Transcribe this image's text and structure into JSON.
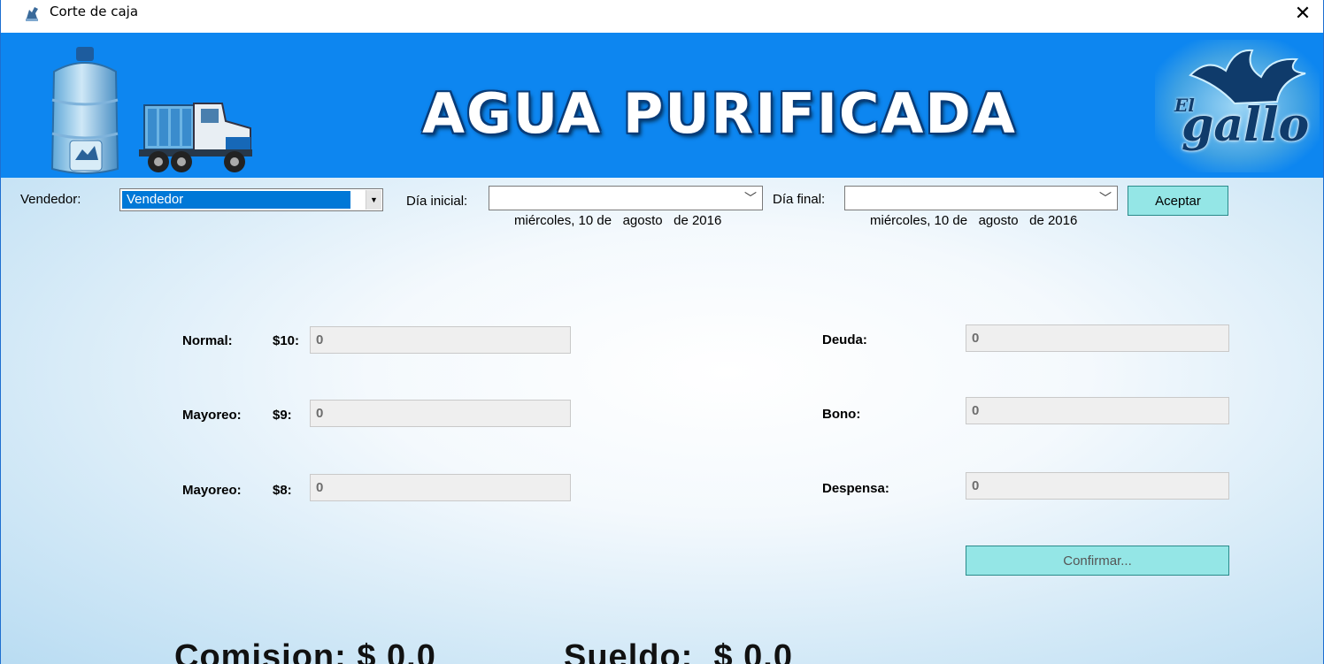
{
  "window": {
    "title": "Corte de caja"
  },
  "banner": {
    "title": "AGUA PURIFICADA",
    "logo_text_top": "El",
    "logo_text_main": "gallo"
  },
  "filters": {
    "vendor_label": "Vendedor:",
    "vendor_value": "Vendedor",
    "start_label": "Día inicial:",
    "start_value": "miércoles, 10 de   agosto   de 2016",
    "end_label": "Día final:",
    "end_value": "miércoles, 10 de   agosto   de 2016",
    "accept_label": "Aceptar"
  },
  "left_fields": [
    {
      "label": "Normal:",
      "price": "$10:",
      "value": "0"
    },
    {
      "label": "Mayoreo:",
      "price": "$9:",
      "value": "0"
    },
    {
      "label": "Mayoreo:",
      "price": "$8:",
      "value": "0"
    }
  ],
  "right_fields": [
    {
      "label": "Deuda:",
      "value": "0"
    },
    {
      "label": "Bono:",
      "value": "0"
    },
    {
      "label": "Despensa:",
      "value": "0"
    }
  ],
  "confirm_label": "Confirmar...",
  "totals": {
    "commission": "Comision: $ 0.0",
    "salary": "Sueldo:  $ 0.0"
  },
  "colors": {
    "banner": "#0d86f0",
    "button": "#94e6e6",
    "selection": "#0078d7"
  }
}
